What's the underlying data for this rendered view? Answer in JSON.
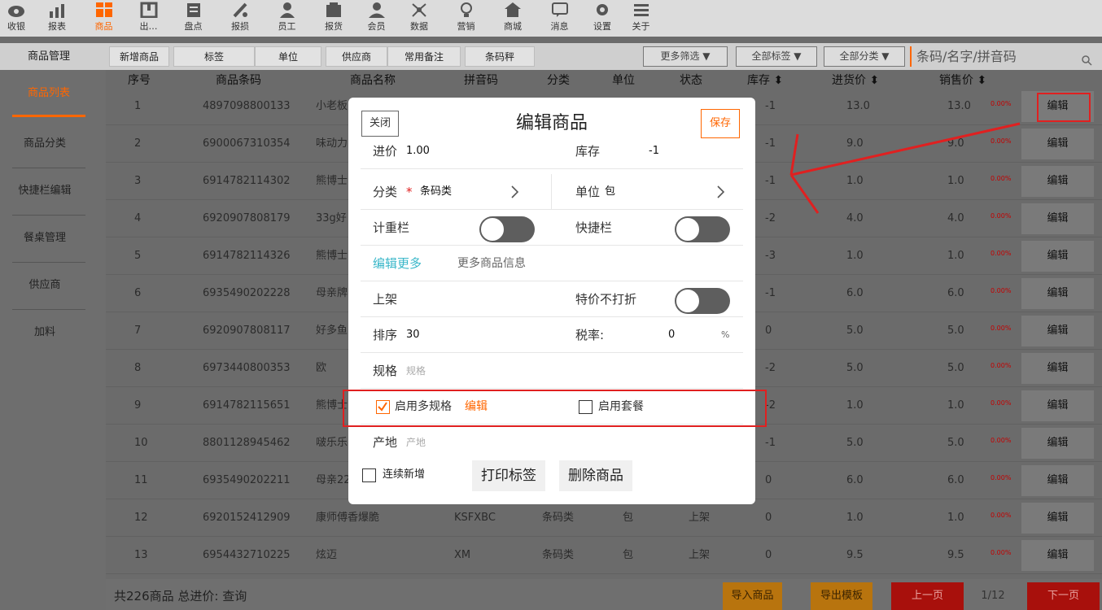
{
  "nav": [
    {
      "label": "收银",
      "icon": "cashier-icon"
    },
    {
      "label": "报表",
      "icon": "report-icon"
    },
    {
      "label": "商品",
      "icon": "goods-icon",
      "active": true
    },
    {
      "label": "出…",
      "icon": "outbound-icon"
    },
    {
      "label": "盘点",
      "icon": "inventory-icon"
    },
    {
      "label": "报损",
      "icon": "damage-icon"
    },
    {
      "label": "员工",
      "icon": "staff-icon"
    },
    {
      "label": "报货",
      "icon": "order-icon"
    },
    {
      "label": "会员",
      "icon": "member-icon"
    },
    {
      "label": "数据",
      "icon": "data-icon"
    },
    {
      "label": "营销",
      "icon": "marketing-icon"
    },
    {
      "label": "商城",
      "icon": "mall-icon"
    },
    {
      "label": "消息",
      "icon": "message-icon"
    },
    {
      "label": "设置",
      "icon": "settings-icon"
    },
    {
      "label": "关于",
      "icon": "about-icon"
    }
  ],
  "toolbar": {
    "title": "商品管理",
    "buttons": [
      "新增商品",
      "标签",
      "单位",
      "供应商",
      "常用备注",
      "条码秤"
    ],
    "filters": [
      "更多筛选 ▼",
      "全部标签 ▼",
      "全部分类 ▼"
    ],
    "search_placeholder": "条码/名字/拼音码"
  },
  "sidebar": [
    "商品列表",
    "商品分类",
    "快捷栏编辑",
    "餐桌管理",
    "供应商",
    "加料"
  ],
  "table": {
    "headers": {
      "no": "序号",
      "barcode": "商品条码",
      "name": "商品名称",
      "pinyin": "拼音码",
      "category": "分类",
      "unit": "单位",
      "status": "状态",
      "stock": "库存 ⬍",
      "buy": "进货价 ⬍",
      "sell": "销售价 ⬍"
    },
    "edit_label": "编辑",
    "rows": [
      {
        "no": "1",
        "barcode": "4897098800133",
        "name": "小老板",
        "pinyin": "",
        "category": "",
        "unit": "",
        "status": "",
        "stock": "-1",
        "buy": "13.0",
        "sell": "13.0",
        "pct": "0.00%"
      },
      {
        "no": "2",
        "barcode": "6900067310354",
        "name": "味动力",
        "pinyin": "",
        "category": "",
        "unit": "",
        "status": "",
        "stock": "-1",
        "buy": "9.0",
        "sell": "9.0",
        "pct": "0.00%"
      },
      {
        "no": "3",
        "barcode": "6914782114302",
        "name": "熊博士",
        "pinyin": "",
        "category": "",
        "unit": "",
        "status": "",
        "stock": "-1",
        "buy": "1.0",
        "sell": "1.0",
        "pct": "0.00%"
      },
      {
        "no": "4",
        "barcode": "6920907808179",
        "name": "33g好",
        "pinyin": "",
        "category": "",
        "unit": "",
        "status": "",
        "stock": "-2",
        "buy": "4.0",
        "sell": "4.0",
        "pct": "0.00%"
      },
      {
        "no": "5",
        "barcode": "6914782114326",
        "name": "熊博士",
        "pinyin": "",
        "category": "",
        "unit": "",
        "status": "",
        "stock": "-3",
        "buy": "1.0",
        "sell": "1.0",
        "pct": "0.00%"
      },
      {
        "no": "6",
        "barcode": "6935490202228",
        "name": "母亲牌",
        "pinyin": "",
        "category": "",
        "unit": "",
        "status": "",
        "stock": "-1",
        "buy": "6.0",
        "sell": "6.0",
        "pct": "0.00%"
      },
      {
        "no": "7",
        "barcode": "6920907808117",
        "name": "好多鱼",
        "pinyin": "",
        "category": "",
        "unit": "",
        "status": "",
        "stock": "0",
        "buy": "5.0",
        "sell": "5.0",
        "pct": "0.00%"
      },
      {
        "no": "8",
        "barcode": "6973440800353",
        "name": "欧",
        "pinyin": "",
        "category": "",
        "unit": "",
        "status": "",
        "stock": "-2",
        "buy": "5.0",
        "sell": "5.0",
        "pct": "0.00%"
      },
      {
        "no": "9",
        "barcode": "6914782115651",
        "name": "熊博士",
        "pinyin": "",
        "category": "",
        "unit": "",
        "status": "",
        "stock": "-2",
        "buy": "1.0",
        "sell": "1.0",
        "pct": "0.00%"
      },
      {
        "no": "10",
        "barcode": "8801128945462",
        "name": "啵乐乐",
        "pinyin": "",
        "category": "",
        "unit": "",
        "status": "",
        "stock": "-1",
        "buy": "5.0",
        "sell": "5.0",
        "pct": "0.00%"
      },
      {
        "no": "11",
        "barcode": "6935490202211",
        "name": "母亲22",
        "pinyin": "",
        "category": "",
        "unit": "",
        "status": "",
        "stock": "0",
        "buy": "6.0",
        "sell": "6.0",
        "pct": "0.00%"
      },
      {
        "no": "12",
        "barcode": "6920152412909",
        "name": "康师傅香爆脆",
        "pinyin": "KSFXBC",
        "category": "条码类",
        "unit": "包",
        "status": "上架",
        "stock": "0",
        "buy": "1.0",
        "sell": "1.0",
        "pct": "0.00%"
      },
      {
        "no": "13",
        "barcode": "6954432710225",
        "name": "炫迈",
        "pinyin": "XM",
        "category": "条码类",
        "unit": "包",
        "status": "上架",
        "stock": "0",
        "buy": "9.5",
        "sell": "9.5",
        "pct": "0.00%"
      }
    ]
  },
  "footer": {
    "summary": "共226商品  总进价: 查询",
    "import": "导入商品",
    "export": "导出模板",
    "prev": "上一页",
    "page": "1/12",
    "next": "下一页"
  },
  "modal": {
    "close": "关闭",
    "title": "编辑商品",
    "save": "保存",
    "buy_label": "进价",
    "buy_value": "1.00",
    "stock_label": "库存",
    "stock_value": "-1",
    "category_label": "分类",
    "category_required": "*",
    "category_value": "条码类",
    "unit_label": "单位",
    "unit_value": "包",
    "weigh_label": "计重栏",
    "quick_label": "快捷栏",
    "edit_more": "编辑更多",
    "more_info": "更多商品信息",
    "shelf_label": "上架",
    "no_discount_label": "特价不打折",
    "sort_label": "排序",
    "sort_value": "30",
    "tax_label": "税率:",
    "tax_value": "0",
    "tax_unit": "%",
    "spec_label": "规格",
    "spec_placeholder": "规格",
    "multi_spec_label": "启用多规格",
    "multi_spec_edit": "编辑",
    "combo_label": "启用套餐",
    "origin_label": "产地",
    "origin_placeholder": "产地",
    "continuous_label": "连续新增",
    "print_label": "打印标签",
    "delete_label": "删除商品"
  },
  "colors": {
    "accent": "#ff6600",
    "annotation": "#e02020",
    "footer_red": "#a8100c",
    "footer_orange": "#b8740e"
  }
}
